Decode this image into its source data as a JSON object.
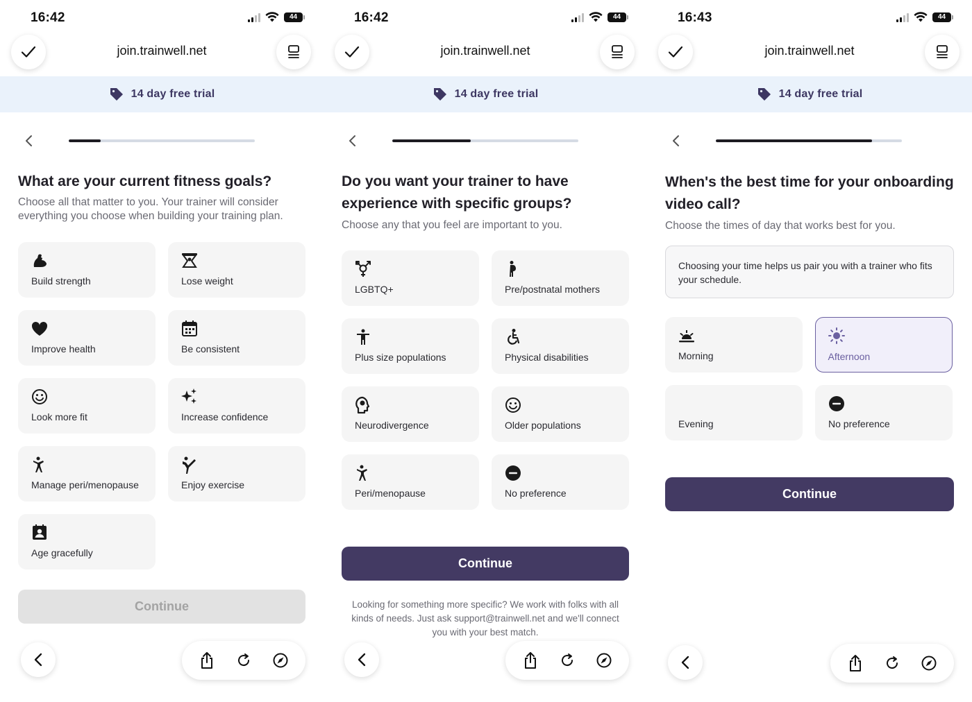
{
  "browser": {
    "url": "join.trainwell.net",
    "promo_text": "14 day free trial",
    "battery": "44"
  },
  "colors": {
    "brand": "#433a63",
    "banner_bg": "#eaf2fb",
    "selected_border": "#6a5fa0"
  },
  "screens": [
    {
      "time": "16:42",
      "progress_fraction": 0.17,
      "question": "What are your current fitness goals?",
      "subtitle": "Choose all that matter to you. Your trainer will consider everything you choose when building your training plan.",
      "options": [
        {
          "label": "Build strength",
          "icon": "flexed-biceps-icon"
        },
        {
          "label": "Lose weight",
          "icon": "scale-icon"
        },
        {
          "label": "Improve health",
          "icon": "heart-icon"
        },
        {
          "label": "Be consistent",
          "icon": "calendar-icon"
        },
        {
          "label": "Look more fit",
          "icon": "smiley-icon"
        },
        {
          "label": "Increase confidence",
          "icon": "sparkles-icon"
        },
        {
          "label": "Manage peri/menopause",
          "icon": "woman-figure-icon"
        },
        {
          "label": "Enjoy exercise",
          "icon": "kicking-figure-icon"
        },
        {
          "label": "Age gracefully",
          "icon": "person-badge-icon"
        }
      ],
      "continue_label": "Continue"
    },
    {
      "time": "16:42",
      "progress_fraction": 0.42,
      "question": "Do you want your trainer to have experience with specific groups?",
      "subtitle": "Choose any that you feel are important to you.",
      "options": [
        {
          "label": "LGBTQ+",
          "icon": "transgender-symbol-icon"
        },
        {
          "label": "Pre/postnatal mothers",
          "icon": "pregnant-woman-icon"
        },
        {
          "label": "Plus size populations",
          "icon": "person-standing-icon"
        },
        {
          "label": "Physical disabilities",
          "icon": "wheelchair-icon"
        },
        {
          "label": "Neurodivergence",
          "icon": "brain-head-icon"
        },
        {
          "label": "Older populations",
          "icon": "smiley-icon"
        },
        {
          "label": "Peri/menopause",
          "icon": "woman-figure-icon"
        },
        {
          "label": "No preference",
          "icon": "minus-circle-icon"
        }
      ],
      "continue_label": "Continue",
      "footnote": "Looking for something more specific? We work with folks with all kinds of needs. Just ask support@trainwell.net and we'll connect you with your best match."
    },
    {
      "time": "16:43",
      "progress_fraction": 0.84,
      "question": "When's the best time for your onboarding video call?",
      "subtitle": "Choose the times of day that works best for you.",
      "info": "Choosing your time helps us pair you with a trainer who fits your schedule.",
      "options": [
        {
          "label": "Morning",
          "icon": "sunrise-icon",
          "selected": false
        },
        {
          "label": "Afternoon",
          "icon": "sun-icon",
          "selected": true
        },
        {
          "label": "Evening",
          "icon": "moon-icon",
          "selected": false
        },
        {
          "label": "No preference",
          "icon": "minus-circle-icon",
          "selected": false
        }
      ],
      "continue_label": "Continue"
    }
  ]
}
